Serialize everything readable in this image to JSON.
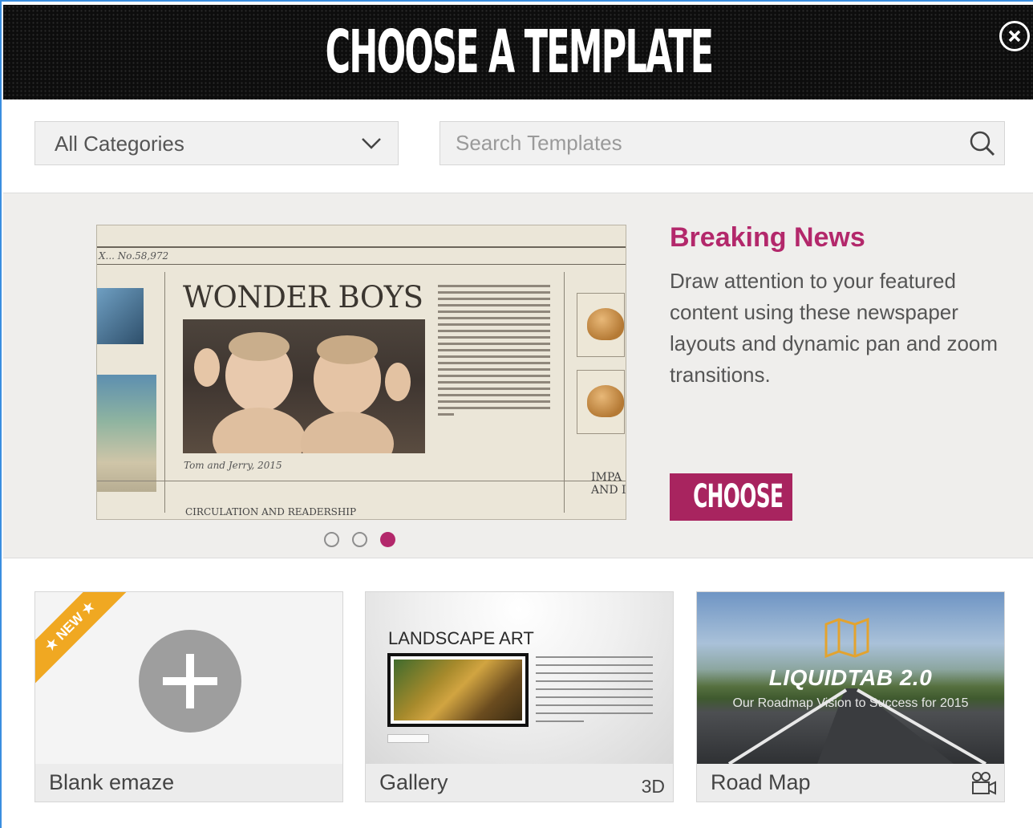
{
  "header": {
    "title": "CHOOSE A TEMPLATE",
    "close_icon": "close-circle-icon"
  },
  "filters": {
    "category_selected": "All Categories",
    "search_placeholder": "Search Templates"
  },
  "featured": {
    "title": "Breaking News",
    "description": "Draw attention to your featured content using these newspaper layouts and dynamic pan and zoom transitions.",
    "choose_label": "CHOOSE",
    "preview": {
      "issue": "X... No.58,972",
      "headline": "WONDER BOYS",
      "caption": "Tom and Jerry, 2015",
      "footer": "CIRCULATION AND READERSHIP",
      "side": "IMPA\nAND I"
    },
    "carousel": {
      "count": 3,
      "active_index": 2
    }
  },
  "templates": [
    {
      "name": "Blank emaze",
      "ribbon": "NEW",
      "icon": "plus-icon"
    },
    {
      "name": "Gallery",
      "badge": "3D",
      "thumb_title": "LANDSCAPE ART"
    },
    {
      "name": "Road Map",
      "icon": "video-camera-icon",
      "thumb_title": "LIQUIDTAB 2.0",
      "thumb_subtitle": "Our Roadmap Vision to Success for 2015"
    }
  ],
  "colors": {
    "accent": "#b3286b",
    "choose_button": "#a8245f",
    "ribbon": "#f0a822",
    "header_bg": "#0d0d0d"
  }
}
